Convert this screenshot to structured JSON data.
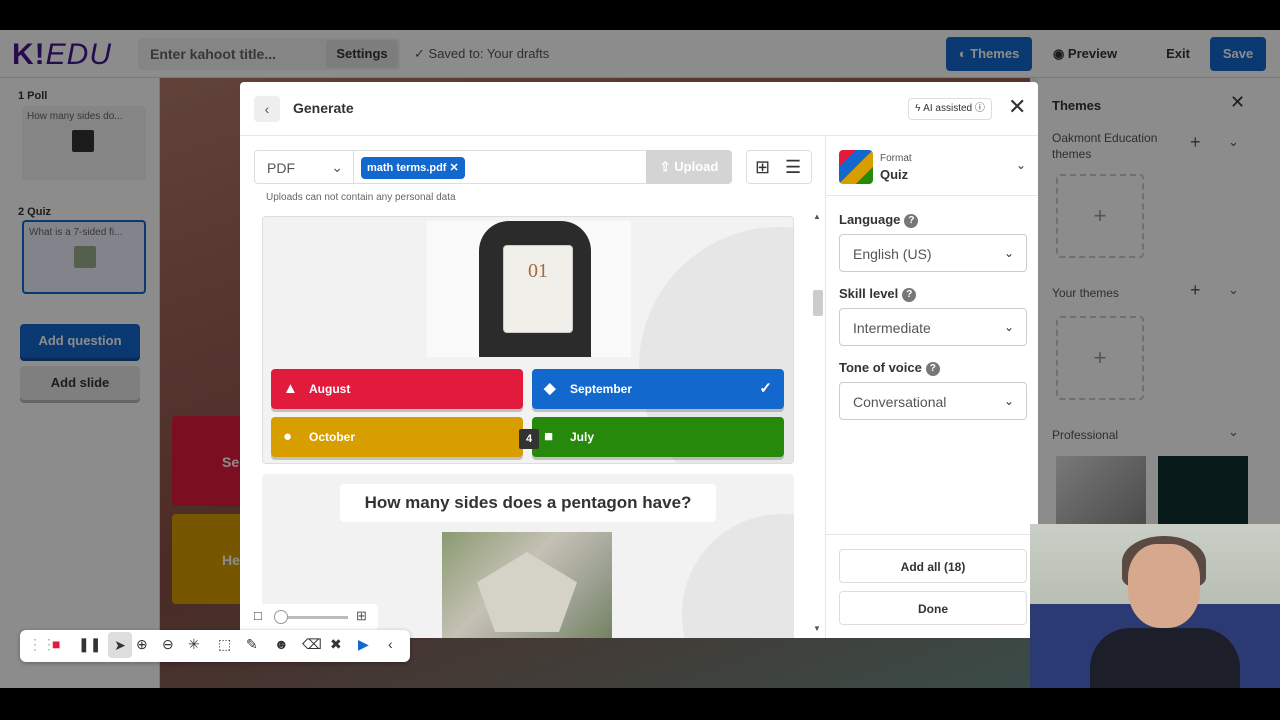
{
  "topbar": {
    "logo": "K!",
    "logo_suffix": "EDU",
    "title_placeholder": "Enter kahoot title...",
    "settings_label": "Settings",
    "saved_status": "Saved to: Your drafts",
    "themes_label": "Themes",
    "preview_label": "Preview",
    "exit_label": "Exit",
    "save_label": "Save"
  },
  "sidebar": {
    "slides": [
      {
        "label": "1  Poll",
        "preview": "How many sides do..."
      },
      {
        "label": "2  Quiz",
        "preview": "What is a 7-sided fi..."
      }
    ],
    "add_question": "Add question",
    "add_slide": "Add slide"
  },
  "canvas": {
    "bg_answer_1": "Se",
    "bg_answer_2": "He"
  },
  "themes_panel": {
    "title": "Themes",
    "org_themes": "Oakmont Education themes",
    "your_themes": "Your themes",
    "professional": "Professional"
  },
  "modal": {
    "title": "Generate",
    "ai_badge": "ϟ AI assisted ⓘ",
    "source_type": "PDF",
    "file_chip": "math terms.pdf",
    "upload_label": "Upload",
    "note": "Uploads can not contain any personal data",
    "question_1": {
      "calendar_text": "01",
      "answers": [
        {
          "text": "August",
          "shape": "▲",
          "color": "#e21b3c"
        },
        {
          "text": "September",
          "shape": "◆",
          "color": "#1368ce",
          "correct": true
        },
        {
          "text": "October",
          "shape": "●",
          "color": "#d89e00"
        },
        {
          "text": "July",
          "shape": "■",
          "color": "#26890c"
        }
      ],
      "answer_count": "4"
    },
    "question_2": {
      "title": "How many sides does a pentagon have?"
    },
    "format": {
      "label": "Format",
      "value": "Quiz"
    },
    "language": {
      "label": "Language",
      "value": "English (US)"
    },
    "skill": {
      "label": "Skill level",
      "value": "Intermediate"
    },
    "tone": {
      "label": "Tone of voice",
      "value": "Conversational"
    },
    "add_all": "Add all (18)",
    "done": "Done"
  },
  "icons": {
    "back": "‹",
    "close": "✕",
    "chevron": "⌄",
    "check": "✓",
    "plus": "+",
    "help": "?"
  }
}
